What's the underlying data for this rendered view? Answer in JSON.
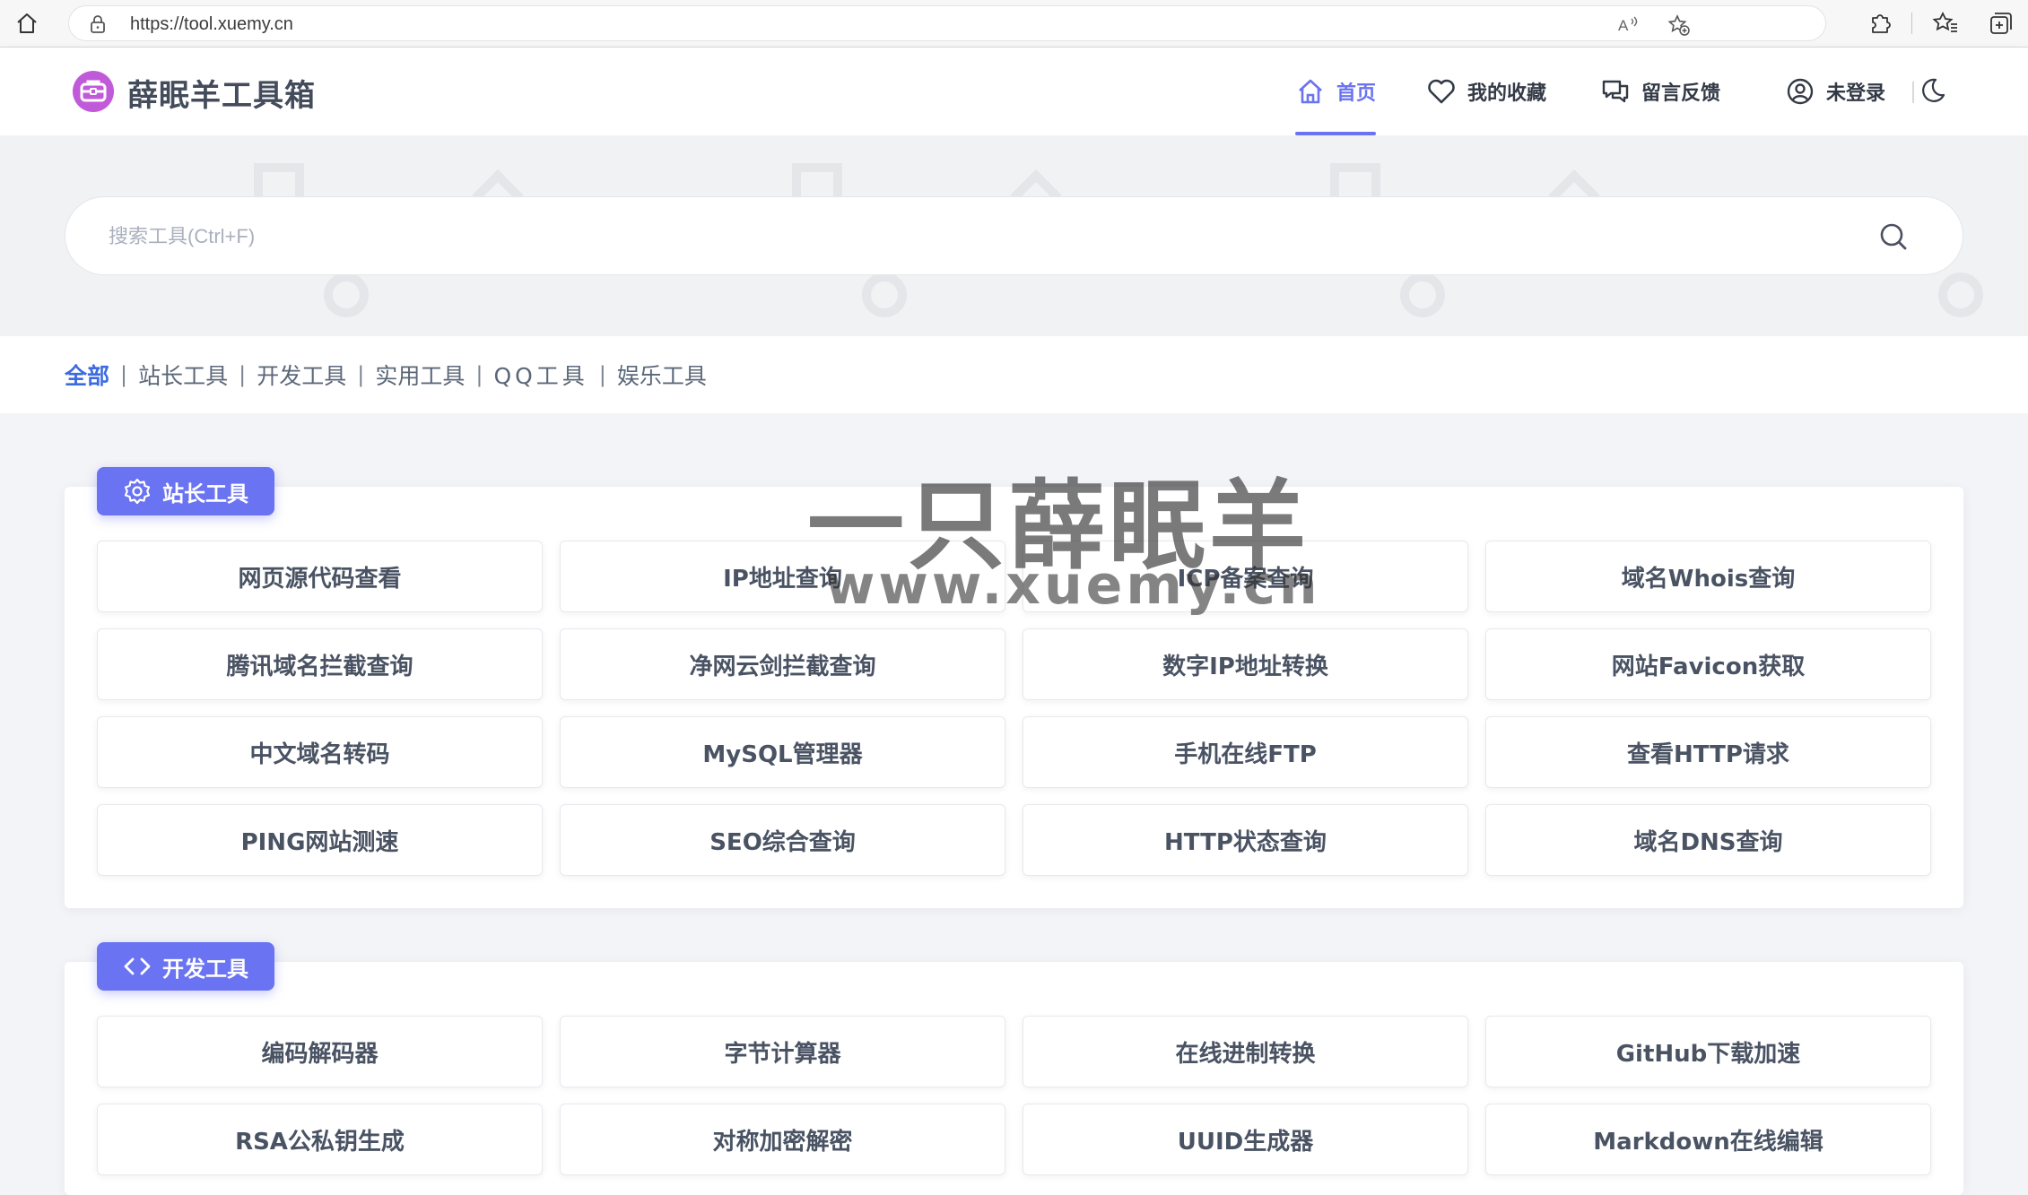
{
  "browser": {
    "url": "https://tool.xuemy.cn"
  },
  "header": {
    "logo_text": "薛眠羊工具箱",
    "nav": {
      "home": "首页",
      "favorites": "我的收藏",
      "feedback": "留言反馈",
      "login": "未登录"
    }
  },
  "search": {
    "placeholder": "搜索工具(Ctrl+F)"
  },
  "categories": [
    "全部",
    "站长工具",
    "开发工具",
    "实用工具",
    "QQ工具",
    "娱乐工具"
  ],
  "sections": [
    {
      "title": "站长工具",
      "icon": "gear-icon",
      "tools": [
        "网页源代码查看",
        "IP地址查询",
        "ICP备案查询",
        "域名Whois查询",
        "腾讯域名拦截查询",
        "净网云剑拦截查询",
        "数字IP地址转换",
        "网站Favicon获取",
        "中文域名转码",
        "MySQL管理器",
        "手机在线FTP",
        "查看HTTP请求",
        "PING网站测速",
        "SEO综合查询",
        "HTTP状态查询",
        "域名DNS查询"
      ]
    },
    {
      "title": "开发工具",
      "icon": "code-icon",
      "tools": [
        "编码解码器",
        "字节计算器",
        "在线进制转换",
        "GitHub下载加速",
        "RSA公私钥生成",
        "对称加密解密",
        "UUID生成器",
        "Markdown在线编辑"
      ]
    }
  ],
  "watermark": {
    "line1": "一只薛眠羊",
    "line2": "www.xuemy.cn"
  },
  "colors": {
    "accent": "#6a73f2",
    "active_category": "#3c6ae0",
    "logo": "#c15ad9"
  }
}
